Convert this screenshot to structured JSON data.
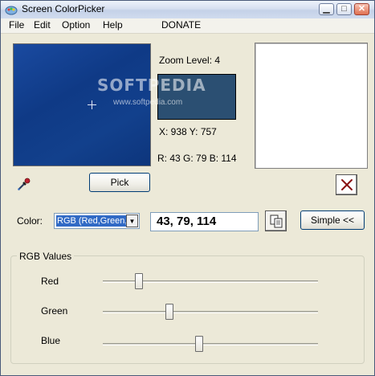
{
  "window": {
    "title": "Screen ColorPicker",
    "minimize": "▁",
    "maximize": "□",
    "close": "✕"
  },
  "menu": {
    "file": "File",
    "edit": "Edit",
    "option": "Option",
    "help": "Help",
    "donate": "DONATE"
  },
  "info": {
    "zoom_level": "Zoom Level: 4",
    "coords": "X: 938 Y: 757",
    "rgb": "R: 43 G: 79 B: 114",
    "preview_color": "#2b4f72"
  },
  "watermark": {
    "main": "SOFTPEDIA",
    "small": "www.softpedia.com"
  },
  "buttons": {
    "pick": "Pick",
    "simple": "Simple <<"
  },
  "color_row": {
    "label": "Color:",
    "format_selected": "RGB (Red,Green,Blue)",
    "value": "43, 79, 114"
  },
  "rgb_group": {
    "legend": "RGB Values",
    "red_label": "Red",
    "green_label": "Green",
    "blue_label": "Blue",
    "red_value": 43,
    "green_value": 79,
    "blue_value": 114,
    "max": 255
  }
}
